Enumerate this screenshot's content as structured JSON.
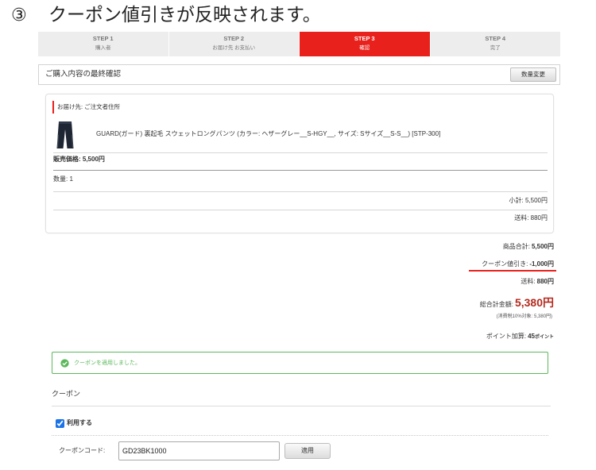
{
  "instruction": {
    "number": "③",
    "text": "クーポン値引きが反映されます。"
  },
  "steps": [
    {
      "step": "STEP 1",
      "label": "購入者",
      "active": false
    },
    {
      "step": "STEP 2",
      "label": "お届け先 お支払い",
      "active": false
    },
    {
      "step": "STEP 3",
      "label": "確認",
      "active": true
    },
    {
      "step": "STEP 4",
      "label": "完了",
      "active": false
    }
  ],
  "confirm": {
    "title": "ご購入内容の最終確認",
    "edit_quantity_button": "数量変更"
  },
  "order": {
    "delivery": "お届け先: ご注文者住所",
    "product_icon": "pants-icon",
    "product_name": "GUARD(ガード) 裏起毛 スウェットロングパンツ (カラー: ヘザーグレー__S-HGY__, サイズ: Sサイズ__S-S__) [STP-300]",
    "price": "販売価格: 5,500円",
    "quantity": "数量: 1",
    "subtotal": "小計: 5,500円",
    "shipping": "送料: 880円"
  },
  "summary": {
    "goods_total": {
      "label": "商品合計:",
      "value": "5,500円"
    },
    "coupon_discount": {
      "label": "クーポン値引き:",
      "value": "-1,000円"
    },
    "shipping": {
      "label": "送料:",
      "value": "880円"
    },
    "grand_total": {
      "label": "総合計金額:",
      "value": "5,380円"
    },
    "tax_note": "(消費税10%対象: 5,380円)",
    "points": {
      "label": "ポイント加算:",
      "value": "45",
      "unit": "ポイント"
    }
  },
  "notice": {
    "icon": "check-circle-icon",
    "message": "クーポンを適用しました。"
  },
  "coupon": {
    "heading": "クーポン",
    "use_label": "利用する",
    "use_checked": true,
    "code_label": "クーポンコード:",
    "code_value": "GD23BK1000",
    "apply_button": "適用"
  },
  "colors": {
    "step_active": "#e8211c",
    "highlight_line": "#e8211c",
    "total_price": "#b4291d",
    "success": "#5cb85c",
    "checkbox": "#1a73e8"
  }
}
